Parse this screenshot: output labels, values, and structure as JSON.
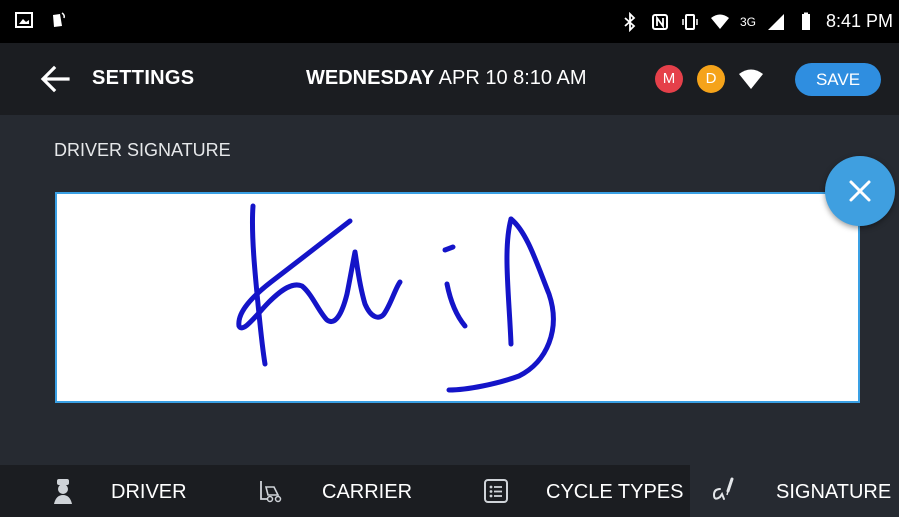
{
  "status_bar": {
    "time": "8:41 PM",
    "network": "3G"
  },
  "app_bar": {
    "title": "SETTINGS",
    "day": "WEDNESDAY",
    "datetime": "APR 10 8:10 AM",
    "avatar_m": "M",
    "avatar_d": "D",
    "save_label": "SAVE"
  },
  "signature_section": {
    "label": "DRIVER SIGNATURE",
    "stroke_color": "#1414c8",
    "border_color": "#3aa0e4"
  },
  "tabs": [
    {
      "label": "DRIVER",
      "icon": "driver-icon"
    },
    {
      "label": "CARRIER",
      "icon": "forklift-icon"
    },
    {
      "label": "CYCLE TYPES",
      "icon": "list-icon"
    },
    {
      "label": "SIGNATURE",
      "icon": "signature-icon"
    }
  ],
  "colors": {
    "accent": "#2f8ee0",
    "background": "#262a31",
    "bar": "#1b1d21"
  }
}
